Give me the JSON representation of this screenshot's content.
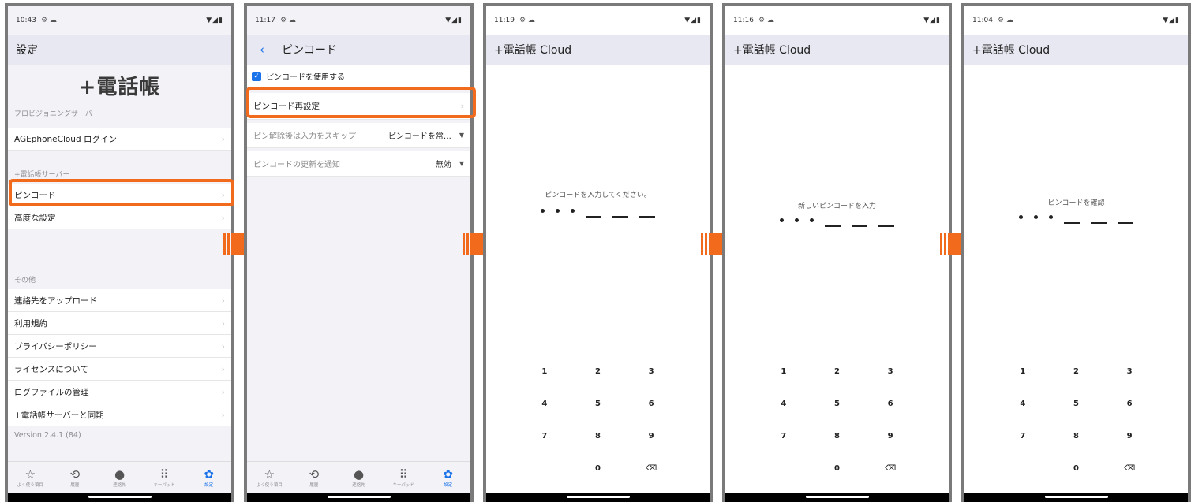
{
  "colors": {
    "accent": "#f26b1d",
    "link": "#1a73e8"
  },
  "status": {
    "icons_right": "▼◢▮"
  },
  "screen1": {
    "time": "10:43",
    "title": "設定",
    "brand": "+電話帳",
    "section_provisioning": "プロビジョニングサーバー",
    "login": "AGEphoneCloud ログイン",
    "section_server": "+電話帳サーバー",
    "pincode": "ピンコード",
    "advanced": "高度な設定",
    "section_other": "その他",
    "upload": "連絡先をアップロード",
    "terms": "利用規約",
    "privacy": "プライバシーポリシー",
    "license": "ライセンスについて",
    "logs": "ログファイルの管理",
    "sync": "+電話帳サーバーと同期",
    "version": "Version 2.4.1 (84)"
  },
  "tabs": [
    {
      "icon": "☆",
      "label": "よく使う項目",
      "icon_name": "star-icon"
    },
    {
      "icon": "⟲",
      "label": "履歴",
      "icon_name": "history-icon"
    },
    {
      "icon": "●",
      "label": "連絡先",
      "icon_name": "person-icon"
    },
    {
      "icon": "⠿",
      "label": "キーパッド",
      "icon_name": "keypad-icon"
    },
    {
      "icon": "✿",
      "label": "設定",
      "icon_name": "gear-icon"
    }
  ],
  "screen2": {
    "time": "11:17",
    "title": "ピンコード",
    "use_pin": "ピンコードを使用する",
    "reset_pin": "ピンコード再設定",
    "skip_label": "ピン解除後は入力をスキップ",
    "skip_value": "ピンコードを常…",
    "notify_label": "ピンコードの更新を通知",
    "notify_value": "無効"
  },
  "pin_screens": [
    {
      "time": "11:19",
      "title": "+電話帳 Cloud",
      "prompt": "ピンコードを入力してください。"
    },
    {
      "time": "11:16",
      "title": "+電話帳 Cloud",
      "prompt": "新しいピンコードを入力"
    },
    {
      "time": "11:04",
      "title": "+電話帳 Cloud",
      "prompt": "ピンコードを確認"
    }
  ],
  "keys": [
    "1",
    "2",
    "3",
    "4",
    "5",
    "6",
    "7",
    "8",
    "9",
    "",
    "0",
    "⌫"
  ]
}
